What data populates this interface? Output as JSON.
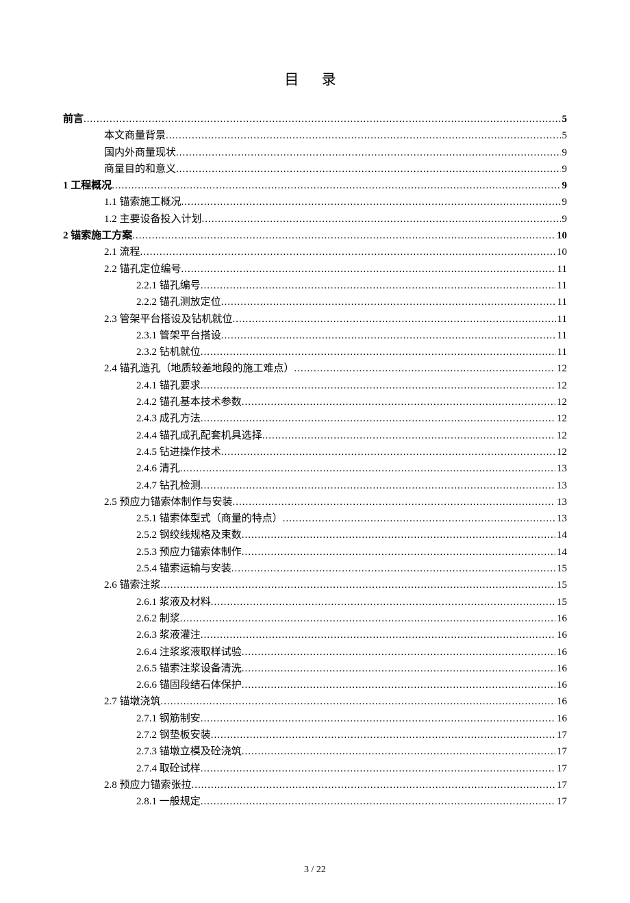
{
  "title": "目 录",
  "footer": "3  /  22",
  "toc": [
    {
      "label": "前言",
      "page": "5",
      "indent": 0,
      "bold": true
    },
    {
      "label": "本文商量背景",
      "page": "5",
      "indent": 1,
      "bold": false
    },
    {
      "label": "国内外商量现状",
      "page": "9",
      "indent": 1,
      "bold": false
    },
    {
      "label": "商量目的和意义",
      "page": "9",
      "indent": 1,
      "bold": false
    },
    {
      "label": "1 工程概况",
      "page": "9",
      "indent": 0,
      "bold": true
    },
    {
      "label": "1.1 锚索施工概况",
      "page": "9",
      "indent": 1,
      "bold": false
    },
    {
      "label": "1.2 主要设备投入计划",
      "page": "9",
      "indent": 1,
      "bold": false
    },
    {
      "label": "2 锚索施工方案",
      "page": "10",
      "indent": 0,
      "bold": true
    },
    {
      "label": "2.1 流程",
      "page": "10",
      "indent": 1,
      "bold": false
    },
    {
      "label": "2.2 锚孔定位编号",
      "page": "11",
      "indent": 1,
      "bold": false
    },
    {
      "label": "2.2.1 锚孔编号",
      "page": "11",
      "indent": 2,
      "bold": false
    },
    {
      "label": "2.2.2 锚孔测放定位",
      "page": "11",
      "indent": 2,
      "bold": false
    },
    {
      "label": "2.3 管架平台搭设及钻机就位",
      "page": "11",
      "indent": 1,
      "bold": false
    },
    {
      "label": "2.3.1 管架平台搭设",
      "page": "11",
      "indent": 2,
      "bold": false
    },
    {
      "label": "2.3.2 钻机就位",
      "page": "11",
      "indent": 2,
      "bold": false
    },
    {
      "label": "2.4 锚孔造孔（地质较差地段的施工难点）",
      "page": "12",
      "indent": 1,
      "bold": false
    },
    {
      "label": "2.4.1 锚孔要求",
      "page": "12",
      "indent": 2,
      "bold": false
    },
    {
      "label": "2.4.2 锚孔基本技术参数",
      "page": "12",
      "indent": 2,
      "bold": false
    },
    {
      "label": "2.4.3 成孔方法",
      "page": "12",
      "indent": 2,
      "bold": false
    },
    {
      "label": "2.4.4 锚孔成孔配套机具选择",
      "page": "12",
      "indent": 2,
      "bold": false
    },
    {
      "label": "2.4.5 钻进操作技术",
      "page": "12",
      "indent": 2,
      "bold": false
    },
    {
      "label": "2.4.6 清孔",
      "page": "13",
      "indent": 2,
      "bold": false
    },
    {
      "label": "2.4.7 钻孔检测",
      "page": "13",
      "indent": 2,
      "bold": false
    },
    {
      "label": "2.5 预应力锚索体制作与安装",
      "page": "13",
      "indent": 1,
      "bold": false
    },
    {
      "label": "2.5.1 锚索体型式（商量的特点）",
      "page": "13",
      "indent": 2,
      "bold": false
    },
    {
      "label": "2.5.2 钢绞线规格及束数",
      "page": "14",
      "indent": 2,
      "bold": false
    },
    {
      "label": "2.5.3 预应力锚索体制作",
      "page": "14",
      "indent": 2,
      "bold": false
    },
    {
      "label": "2.5.4 锚索运输与安装",
      "page": "15",
      "indent": 2,
      "bold": false
    },
    {
      "label": "2.6 锚索注浆",
      "page": "15",
      "indent": 1,
      "bold": false
    },
    {
      "label": "2.6.1 浆液及材料",
      "page": "15",
      "indent": 2,
      "bold": false
    },
    {
      "label": "2.6.2 制浆",
      "page": "16",
      "indent": 2,
      "bold": false
    },
    {
      "label": "2.6.3 浆液灌注",
      "page": "16",
      "indent": 2,
      "bold": false
    },
    {
      "label": "2.6.4 注浆浆液取样试验",
      "page": "16",
      "indent": 2,
      "bold": false
    },
    {
      "label": "2.6.5 锚索注浆设备清洗",
      "page": "16",
      "indent": 2,
      "bold": false
    },
    {
      "label": "2.6.6 锚固段结石体保护",
      "page": "16",
      "indent": 2,
      "bold": false
    },
    {
      "label": "2.7 锚墩浇筑",
      "page": "16",
      "indent": 1,
      "bold": false
    },
    {
      "label": "2.7.1 钢筋制安",
      "page": "16",
      "indent": 2,
      "bold": false
    },
    {
      "label": "2.7.2 钢垫板安装",
      "page": "17",
      "indent": 2,
      "bold": false
    },
    {
      "label": "2.7.3 锚墩立模及砼浇筑",
      "page": "17",
      "indent": 2,
      "bold": false
    },
    {
      "label": "2.7.4 取砼试样",
      "page": "17",
      "indent": 2,
      "bold": false
    },
    {
      "label": "2.8 预应力锚索张拉",
      "page": "17",
      "indent": 1,
      "bold": false
    },
    {
      "label": "2.8.1 一般规定",
      "page": "17",
      "indent": 2,
      "bold": false
    }
  ]
}
